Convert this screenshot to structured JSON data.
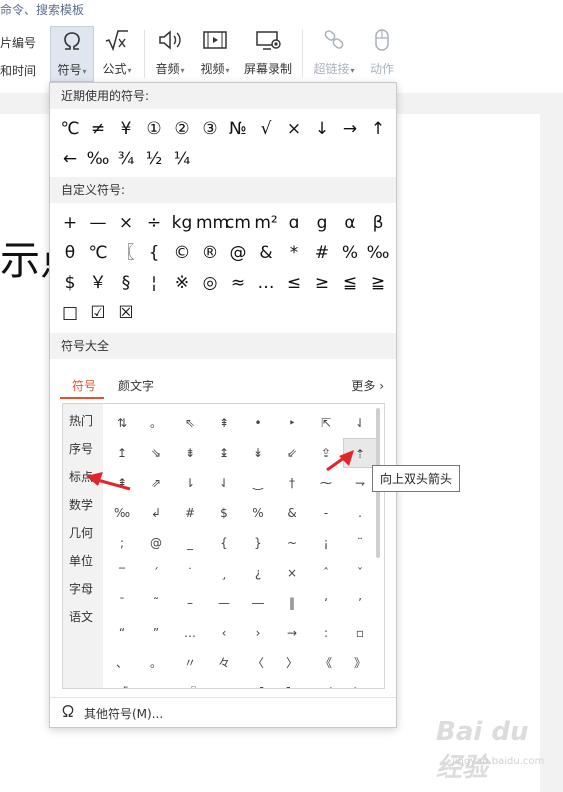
{
  "topbar": {
    "command_search": "命令、搜索模板"
  },
  "ribbon": {
    "left_labels": [
      "片编号",
      "和时间"
    ],
    "buttons": [
      {
        "label": "符号",
        "icon": "omega-icon",
        "dropdown": true,
        "active": true
      },
      {
        "label": "公式",
        "icon": "formula-icon",
        "dropdown": true
      },
      {
        "label": "音频",
        "icon": "speaker-icon",
        "dropdown": true
      },
      {
        "label": "视频",
        "icon": "video-icon",
        "dropdown": true
      },
      {
        "label": "屏幕录制",
        "icon": "screen-record-icon",
        "dropdown": false
      },
      {
        "label": "超链接",
        "icon": "link-icon",
        "dropdown": true,
        "disabled": true
      },
      {
        "label": "动作",
        "icon": "mouse-icon",
        "dropdown": false,
        "disabled": true
      }
    ]
  },
  "document": {
    "visible_text": "示点"
  },
  "panel": {
    "recent_title": "近期使用的符号:",
    "recent": [
      "℃",
      "≠",
      "¥",
      "①",
      "②",
      "③",
      "№",
      "√",
      "×",
      "↓",
      "→",
      "↑",
      "←",
      "‰",
      "¾",
      "½",
      "¼"
    ],
    "custom_title": "自定义符号:",
    "custom": [
      "+",
      "—",
      "×",
      "÷",
      "kg",
      "mm",
      "cm",
      "m²",
      "ɑ",
      "g",
      "α",
      "β",
      "θ",
      "℃",
      "〖",
      "{",
      "©",
      "®",
      "@",
      "&",
      "*",
      "#",
      "%",
      "‰",
      "$",
      "￥",
      "§",
      "¦",
      "※",
      "◎",
      "≈",
      "…",
      "≤",
      "≥",
      "≦",
      "≧",
      "□",
      "☑",
      "☒"
    ],
    "all_title": "符号大全",
    "tabs": [
      {
        "label": "符号",
        "active": true
      },
      {
        "label": "颜文字",
        "active": false
      }
    ],
    "more_label": "更多",
    "categories": [
      "热门",
      "序号",
      "标点",
      "数学",
      "几何",
      "单位",
      "字母",
      "语文"
    ],
    "grid": [
      [
        "⇅",
        "。",
        "⇖",
        "⇞",
        "•",
        "‣",
        "⇱",
        "⇃"
      ],
      [
        "↥",
        "⇘",
        "⇟",
        "↨",
        "↡",
        "⇙",
        "⇪",
        "⇡"
      ],
      [
        "⇞",
        "⇗",
        "⇂",
        "⇃",
        "‿",
        "†",
        "⁓",
        "⇁"
      ],
      [
        "‰",
        "↲",
        "#",
        "$",
        "%",
        "&",
        "-",
        "."
      ],
      [
        ";",
        "@",
        "_",
        "{",
        "}",
        "~",
        "¡",
        "¨"
      ],
      [
        "‾",
        "ˊ",
        "˙",
        "¸",
        "¿",
        "×",
        "ˆ",
        "ˇ"
      ],
      [
        "ˉ",
        "˜",
        "–",
        "—",
        "―",
        "‖",
        "‘",
        "’"
      ],
      [
        "“",
        "”",
        "…",
        "‹",
        "›",
        "→",
        ":",
        "▫"
      ],
      [
        "、",
        "。",
        "〃",
        "々",
        "〈",
        "〉",
        "《",
        "》"
      ],
      [
        "「",
        "」",
        "『",
        "』",
        "【",
        "】",
        "〔",
        "〕"
      ]
    ],
    "selected_symbol_tooltip": "向上双头箭头",
    "footer_label": "其他符号(M)..."
  },
  "watermark": {
    "text": "Bai du 经验",
    "sub": "jingyan.baidu.com"
  },
  "colors": {
    "accent": "#e8512c",
    "arrow": "#e0262a"
  }
}
